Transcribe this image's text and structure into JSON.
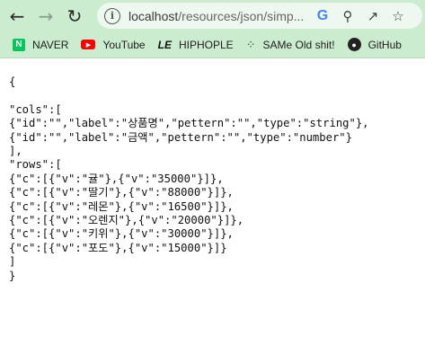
{
  "browser": {
    "url_host": "localhost",
    "url_path": "/resources/json/simp...",
    "back_icon": "arrow-left-icon",
    "forward_icon": "arrow-right-icon",
    "reload_icon": "reload-icon"
  },
  "bookmarks": [
    {
      "label": "NAVER",
      "icon": "naver-icon",
      "glyph": "N"
    },
    {
      "label": "YouTube",
      "icon": "youtube-icon",
      "glyph": "▶"
    },
    {
      "label": "HIPHOPLE",
      "icon": "hiphople-icon",
      "glyph": "LE"
    },
    {
      "label": "SAMe Old shit!",
      "icon": "dots-icon",
      "glyph": "⁘"
    },
    {
      "label": "GitHub",
      "icon": "github-icon",
      "glyph": "●"
    }
  ],
  "json_lines": [
    "{",
    "",
    "\"cols\":[",
    "{\"id\":\"\",\"label\":\"상품명\",\"pettern\":\"\",\"type\":\"string\"},",
    "{\"id\":\"\",\"label\":\"금액\",\"pettern\":\"\",\"type\":\"number\"}",
    "],",
    "\"rows\":[",
    "{\"c\":[{\"v\":\"귤\"},{\"v\":\"35000\"}]},",
    "{\"c\":[{\"v\":\"딸기\"},{\"v\":\"88000\"}]},",
    "{\"c\":[{\"v\":\"레몬\"},{\"v\":\"16500\"}]},",
    "{\"c\":[{\"v\":\"오렌지\"},{\"v\":\"20000\"}]},",
    "{\"c\":[{\"v\":\"키위\"},{\"v\":\"30000\"}]},",
    "{\"c\":[{\"v\":\"포도\"},{\"v\":\"15000\"}]}",
    "]",
    "}"
  ]
}
